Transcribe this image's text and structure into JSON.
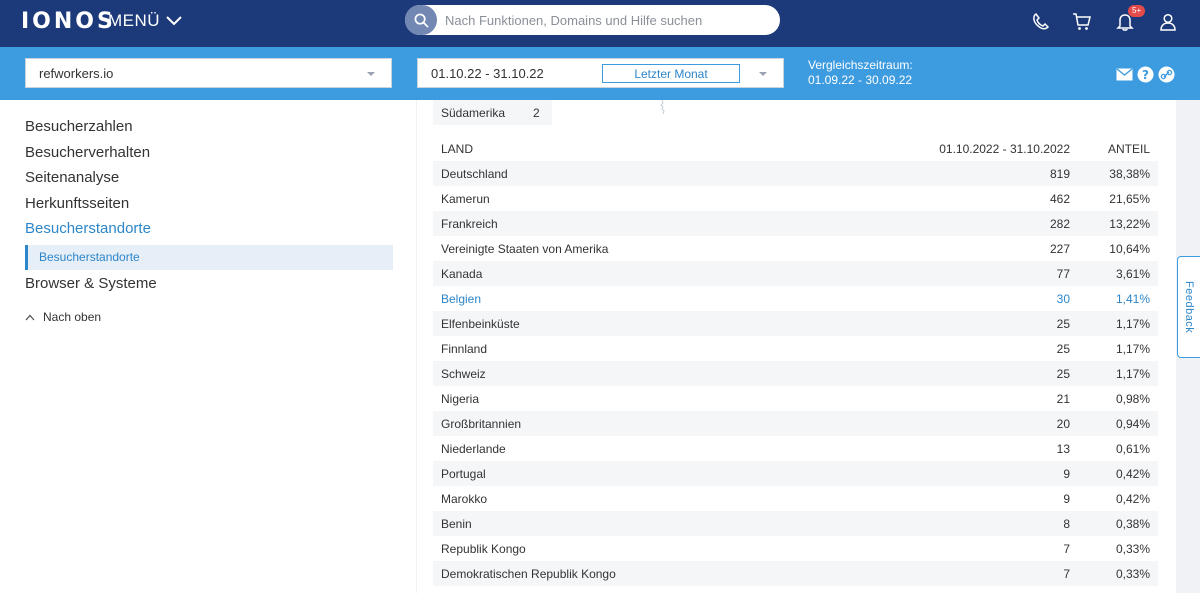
{
  "header": {
    "logo": "IONOS",
    "menu_label": "MENÜ",
    "search_placeholder": "Nach Funktionen, Domains und Hilfe suchen",
    "notification_badge": "5+"
  },
  "filters": {
    "site": "refworkers.io",
    "date_range": "01.10.22 - 31.10.22",
    "preset": "Letzter Monat",
    "compare_label": "Vergleichszeitraum:",
    "compare_range": "01.09.22 - 30.09.22"
  },
  "sidebar": {
    "items": [
      {
        "label": "Besucherzahlen"
      },
      {
        "label": "Besucherverhalten"
      },
      {
        "label": "Seitenanalyse"
      },
      {
        "label": "Herkunftsseiten"
      },
      {
        "label": "Besucherstandorte"
      },
      {
        "label": "Browser & Systeme"
      }
    ],
    "sub_item": "Besucherstandorte",
    "to_top": "Nach oben"
  },
  "region_row": {
    "name": "Südamerika",
    "value": "2"
  },
  "table": {
    "headers": {
      "land": "LAND",
      "period": "01.10.2022 - 31.10.2022",
      "share": "ANTEIL"
    },
    "rows": [
      {
        "land": "Deutschland",
        "count": "819",
        "share": "38,38%"
      },
      {
        "land": "Kamerun",
        "count": "462",
        "share": "21,65%"
      },
      {
        "land": "Frankreich",
        "count": "282",
        "share": "13,22%"
      },
      {
        "land": "Vereinigte Staaten von Amerika",
        "count": "227",
        "share": "10,64%"
      },
      {
        "land": "Kanada",
        "count": "77",
        "share": "3,61%"
      },
      {
        "land": "Belgien",
        "count": "30",
        "share": "1,41%"
      },
      {
        "land": "Elfenbeinküste",
        "count": "25",
        "share": "1,17%"
      },
      {
        "land": "Finnland",
        "count": "25",
        "share": "1,17%"
      },
      {
        "land": "Schweiz",
        "count": "25",
        "share": "1,17%"
      },
      {
        "land": "Nigeria",
        "count": "21",
        "share": "0,98%"
      },
      {
        "land": "Großbritannien",
        "count": "20",
        "share": "0,94%"
      },
      {
        "land": "Niederlande",
        "count": "13",
        "share": "0,61%"
      },
      {
        "land": "Portugal",
        "count": "9",
        "share": "0,42%"
      },
      {
        "land": "Marokko",
        "count": "9",
        "share": "0,42%"
      },
      {
        "land": "Benin",
        "count": "8",
        "share": "0,38%"
      },
      {
        "land": "Republik Kongo",
        "count": "7",
        "share": "0,33%"
      },
      {
        "land": "Demokratischen Republik Kongo",
        "count": "7",
        "share": "0,33%"
      }
    ]
  },
  "feedback_label": "Feedback",
  "colors": {
    "topbar": "#1c3a7a",
    "filterbar": "#3d9be0",
    "accent": "#2d86c8",
    "row_alt": "#f5f6f8"
  },
  "icons": [
    "search-icon",
    "chevron-down-icon",
    "phone-icon",
    "cart-icon",
    "bell-icon",
    "user-icon",
    "mail-icon",
    "help-icon",
    "link-icon",
    "chevron-up-icon"
  ]
}
